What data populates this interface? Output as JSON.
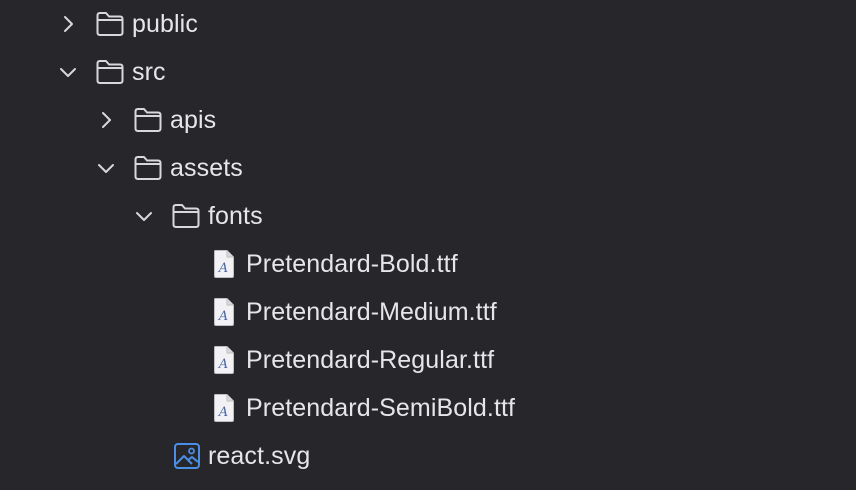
{
  "tree": {
    "public": {
      "label": "public",
      "expanded": false
    },
    "src": {
      "label": "src",
      "expanded": true
    },
    "apis": {
      "label": "apis",
      "expanded": false
    },
    "assets": {
      "label": "assets",
      "expanded": true
    },
    "fonts": {
      "label": "fonts",
      "expanded": true
    },
    "files": [
      {
        "label": "Pretendard-Bold.ttf",
        "icon": "font-file-icon"
      },
      {
        "label": "Pretendard-Medium.ttf",
        "icon": "font-file-icon"
      },
      {
        "label": "Pretendard-Regular.ttf",
        "icon": "font-file-icon"
      },
      {
        "label": "Pretendard-SemiBold.ttf",
        "icon": "font-file-icon"
      }
    ],
    "react_svg": {
      "label": "react.svg",
      "icon": "image-file-icon"
    }
  },
  "colors": {
    "background": "#27272b",
    "text": "#e6e6ea",
    "icon_stroke": "#d8d8dc",
    "image_icon": "#4a8fe6"
  }
}
